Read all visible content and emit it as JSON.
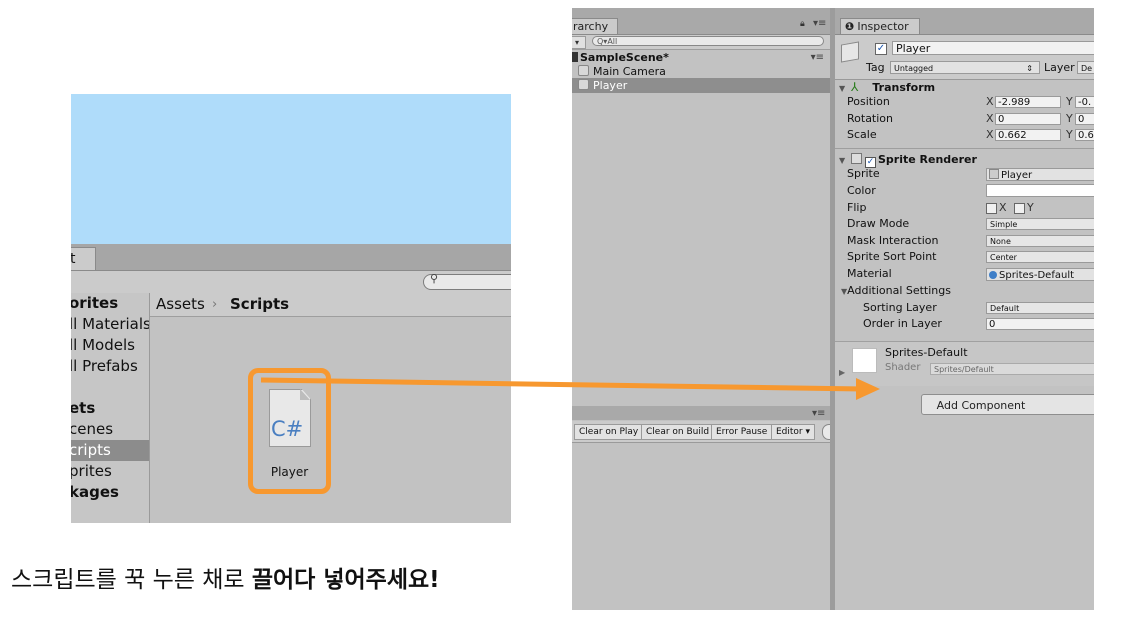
{
  "colors": {
    "highlight_orange": "#f7982f",
    "scene_sky": "#afdcfa",
    "selection_gray": "#8e8e8e"
  },
  "project": {
    "tab_label": "t",
    "sidebar": [
      {
        "label": "orites",
        "bold": true
      },
      {
        "label": "ll Materials",
        "bold": false
      },
      {
        "label": "ll Models",
        "bold": false
      },
      {
        "label": "ll Prefabs",
        "bold": false
      },
      {
        "label": "ets",
        "bold": true
      },
      {
        "label": "cenes",
        "bold": false
      },
      {
        "label": "cripts",
        "bold": false,
        "selected": true
      },
      {
        "label": "prites",
        "bold": false
      },
      {
        "label": "kages",
        "bold": true
      }
    ],
    "breadcrumb": {
      "root": "Assets",
      "separator": "›",
      "current": "Scripts"
    },
    "asset": {
      "icon_text": "C#",
      "name": "Player"
    }
  },
  "caption": {
    "normal": "스크립트를 꾹 누른 채로 ",
    "bold": "끌어다 넣어주세요!"
  },
  "hierarchy": {
    "tab_label": "rarchy",
    "create_label": "▾",
    "search_placeholder": "Q▾All",
    "scene_name": "SampleScene*",
    "items": [
      {
        "label": "Main Camera",
        "selected": false
      },
      {
        "label": "Player",
        "selected": true
      }
    ]
  },
  "console": {
    "buttons": [
      "Clear on Play",
      "Clear on Build",
      "Error Pause",
      "Editor ▾"
    ]
  },
  "inspector": {
    "tab_label": "Inspector",
    "object_name": "Player",
    "tag_label": "Tag",
    "tag_value": "Untagged",
    "layer_label": "Layer",
    "layer_value": "De",
    "transform": {
      "title": "Transform",
      "position": {
        "label": "Position",
        "x": "-2.989",
        "y": "-0."
      },
      "rotation": {
        "label": "Rotation",
        "x": "0",
        "y": "0"
      },
      "scale": {
        "label": "Scale",
        "x": "0.662",
        "y": "0.6"
      }
    },
    "sprite_renderer": {
      "title": "Sprite Renderer",
      "sprite_label": "Sprite",
      "sprite_value": "Player",
      "color_label": "Color",
      "flip_label": "Flip",
      "flip_x": "X",
      "flip_y": "Y",
      "draw_mode_label": "Draw Mode",
      "draw_mode_value": "Simple",
      "mask_label": "Mask Interaction",
      "mask_value": "None",
      "sort_point_label": "Sprite Sort Point",
      "sort_point_value": "Center",
      "material_label": "Material",
      "material_value": "Sprites-Default",
      "additional_label": "Additional Settings",
      "sorting_layer_label": "Sorting Layer",
      "sorting_layer_value": "Default",
      "order_label": "Order in Layer",
      "order_value": "0"
    },
    "material": {
      "name": "Sprites-Default",
      "shader_label": "Shader",
      "shader_value": "Sprites/Default"
    },
    "add_component": "Add Component"
  }
}
